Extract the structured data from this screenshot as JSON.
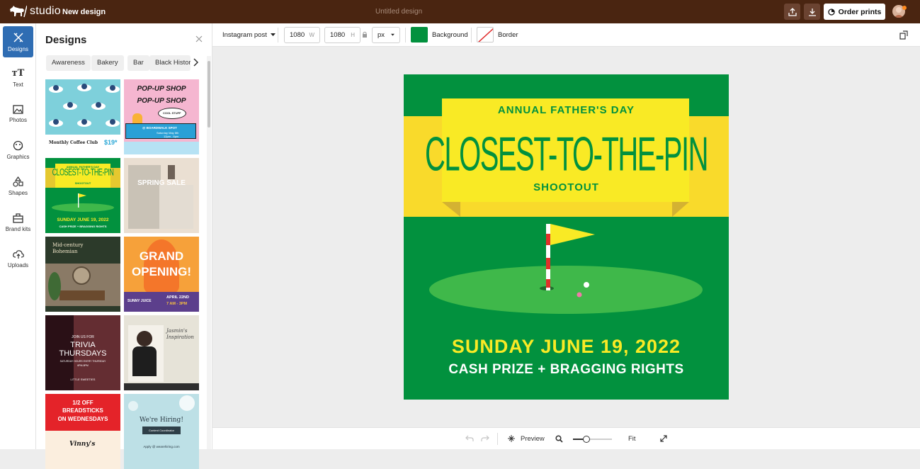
{
  "app": {
    "brand": "studio",
    "section": "New design",
    "document_title": "Untitled design",
    "order_label": "Order prints"
  },
  "rail": [
    {
      "label": "Designs",
      "icon": "designs-icon"
    },
    {
      "label": "Text",
      "icon": "text-icon"
    },
    {
      "label": "Photos",
      "icon": "photos-icon"
    },
    {
      "label": "Graphics",
      "icon": "graphics-icon"
    },
    {
      "label": "Shapes",
      "icon": "shapes-icon"
    },
    {
      "label": "Brand kits",
      "icon": "brand-kits-icon"
    },
    {
      "label": "Uploads",
      "icon": "uploads-icon"
    }
  ],
  "panel": {
    "title": "Designs",
    "chips": [
      "Awareness",
      "Bakery",
      "Bar",
      "Black History"
    ],
    "thumbs": {
      "coffee": {
        "title": "Monthly Coffee Club",
        "price": "$19*"
      },
      "popup": {
        "line1": "POP-UP SHOP",
        "line2": "POP-UP SHOP",
        "tag": "COOL STUFF",
        "place": "@ BOARDWALK SPOT",
        "date": "Saturday May 8th",
        "time": "12pm - 6pm"
      },
      "golf": {
        "line1": "ANNUAL FATHER'S DAY",
        "line2": "CLOSEST-TO-THE-PIN",
        "line3": "SHOOTOUT",
        "date": "SUNDAY JUNE 19, 2022",
        "prize": "CASH PRIZE + BRAGGING RIGHTS"
      },
      "spring": {
        "title": "SPRING SALE"
      },
      "bohemian": {
        "title": "Mid-century Bohemian"
      },
      "opening": {
        "line1": "GRAND",
        "line2": "OPENING!",
        "brand": "SUNNY JUICE",
        "date": "APRIL 22ND",
        "time": "7 AM - 3PM"
      },
      "trivia": {
        "pre": "JOIN US FOR",
        "line1": "TRIVIA",
        "line2": "THURSDAYS",
        "sub": "SATURDAY HOURS EVERY THURSDAY",
        "time": "6PM-8PM",
        "brand": "LITTLE SWEETIES"
      },
      "jasmin": {
        "line1": "Jasmin's",
        "line2": "Inspiration"
      },
      "bread": {
        "line1": "1/2 OFF",
        "line2": "BREADSTICKS",
        "line3": "ON WEDNESDAYS",
        "brand": "Vinny's"
      },
      "hiring": {
        "title": "We're Hiring!",
        "role": "Content Coordinator",
        "apply": "Apply @ wearehiring.com"
      }
    }
  },
  "toolbar": {
    "format": "Instagram post",
    "width": "1080",
    "width_unit": "W",
    "height": "1080",
    "height_unit": "H",
    "unit": "px",
    "background_label": "Background",
    "border_label": "Border",
    "background_color": "#02913e"
  },
  "canvas": {
    "line1": "ANNUAL FATHER'S DAY",
    "line2": "CLOSEST-TO-THE-PIN",
    "line3": "SHOOTOUT",
    "date": "SUNDAY JUNE 19, 2022",
    "prize": "CASH PRIZE + BRAGGING RIGHTS",
    "colors": {
      "green": "#02913e",
      "yellow": "#f9ea25",
      "banner_fold": "#e8c62a"
    }
  },
  "bottom": {
    "preview": "Preview",
    "fit": "Fit"
  }
}
